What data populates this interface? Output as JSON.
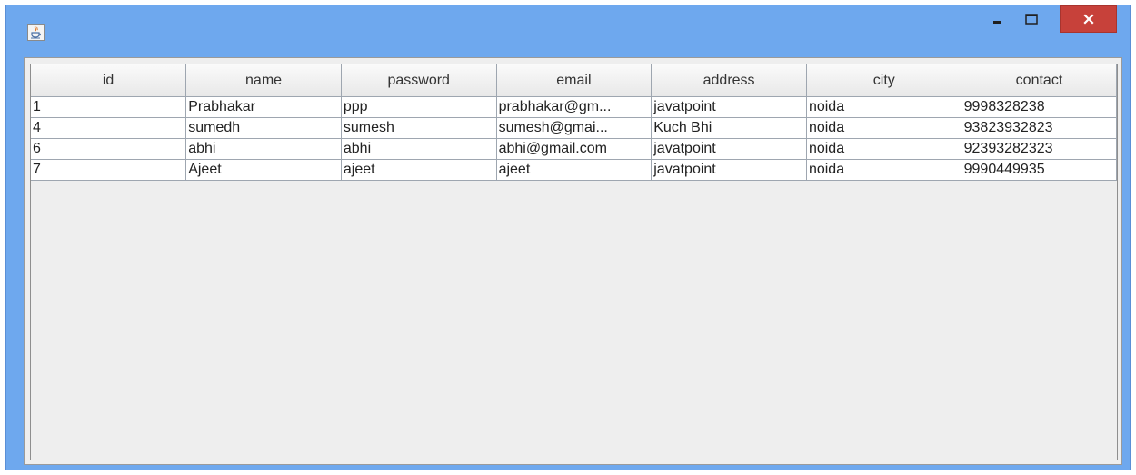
{
  "window": {
    "title": ""
  },
  "table": {
    "columns": [
      "id",
      "name",
      "password",
      "email",
      "address",
      "city",
      "contact"
    ],
    "rows": [
      [
        "1",
        "Prabhakar",
        "ppp",
        "prabhakar@gm...",
        "javatpoint",
        "noida",
        "9998328238"
      ],
      [
        "4",
        "sumedh",
        "sumesh",
        "sumesh@gmai...",
        "Kuch Bhi",
        "noida",
        "93823932823"
      ],
      [
        "6",
        "abhi",
        "abhi",
        "abhi@gmail.com",
        "javatpoint",
        "noida",
        "92393282323"
      ],
      [
        "7",
        "Ajeet",
        "ajeet",
        "ajeet",
        "javatpoint",
        "noida",
        "9990449935"
      ]
    ]
  },
  "icons": {
    "app": "java-coffee-cup-icon",
    "minimize": "minimize-icon",
    "maximize": "maximize-icon",
    "close": "close-icon"
  }
}
